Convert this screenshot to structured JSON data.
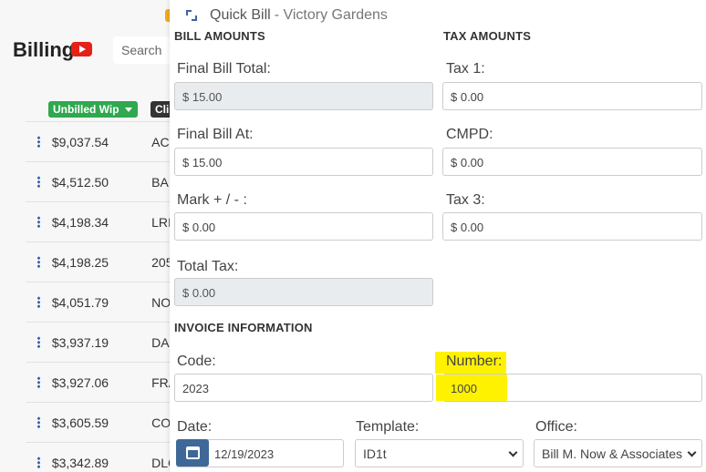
{
  "background": {
    "title": "Billing",
    "search_placeholder": "Search",
    "columns": {
      "wip": "Unbilled Wip",
      "client": "Cli"
    },
    "rows": [
      {
        "amount": "$9,037.54",
        "client": "AC"
      },
      {
        "amount": "$4,512.50",
        "client": "BA"
      },
      {
        "amount": "$4,198.34",
        "client": "LRI"
      },
      {
        "amount": "$4,198.25",
        "client": "205"
      },
      {
        "amount": "$4,051.79",
        "client": "NO"
      },
      {
        "amount": "$3,937.19",
        "client": "DA"
      },
      {
        "amount": "$3,927.06",
        "client": "FRA"
      },
      {
        "amount": "$3,605.59",
        "client": "CO"
      },
      {
        "amount": "$3,342.89",
        "client": "DLC"
      }
    ]
  },
  "modal": {
    "title": "Quick Bill",
    "subtitle": "- Victory Gardens",
    "bill_amounts": {
      "heading": "BILL AMOUNTS",
      "final_bill_total_label": "Final Bill Total:",
      "final_bill_total_value": "$ 15.00",
      "final_bill_at_label": "Final Bill At:",
      "final_bill_at_value": "$ 15.00",
      "markup_label": "Mark + / - :",
      "markup_value": "$ 0.00",
      "total_tax_label": "Total Tax:",
      "total_tax_value": "$ 0.00"
    },
    "tax_amounts": {
      "heading": "TAX AMOUNTS",
      "tax1_label": "Tax 1:",
      "tax1_value": "$ 0.00",
      "cmpd_label": "CMPD:",
      "cmpd_value": "$ 0.00",
      "tax3_label": "Tax 3:",
      "tax3_value": "$ 0.00"
    },
    "invoice": {
      "heading": "INVOICE INFORMATION",
      "code_label": "Code:",
      "code_value": "2023",
      "number_label": "Number:",
      "number_value": "1000",
      "date_label": "Date:",
      "date_value": "12/19/2023",
      "template_label": "Template:",
      "template_value": "ID1t",
      "office_label": "Office:",
      "office_value": "Bill M. Now & Associates"
    }
  },
  "colors": {
    "accent": "#3e6897",
    "wip_badge": "#2fa84f",
    "highlight": "#fff200"
  }
}
